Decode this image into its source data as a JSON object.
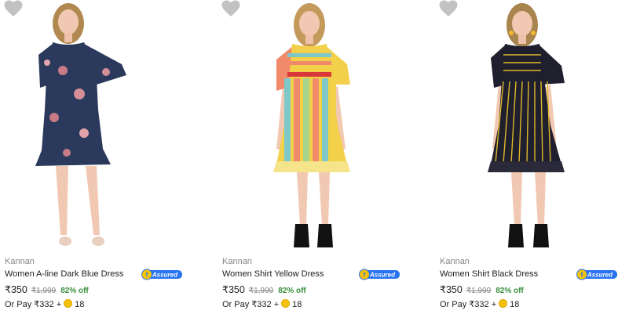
{
  "products": [
    {
      "brand": "Kannan",
      "title": "Women A-line Dark Blue Dress",
      "price": "₹350",
      "mrp": "₹1,999",
      "discount": "82% off",
      "pay_prefix": "Or Pay ₹332 +",
      "coins": "18",
      "assured_label": "Assured",
      "dress_color": "#2b3a5c",
      "icon": "heart-icon"
    },
    {
      "brand": "Kannan",
      "title": "Women Shirt Yellow Dress",
      "price": "₹350",
      "mrp": "₹1,999",
      "discount": "82% off",
      "pay_prefix": "Or Pay ₹332 +",
      "coins": "18",
      "assured_label": "Assured",
      "dress_color": "#f2d04a",
      "icon": "heart-icon"
    },
    {
      "brand": "Kannan",
      "title": "Women Shirt Black Dress",
      "price": "₹350",
      "mrp": "₹1,999",
      "discount": "82% off",
      "pay_prefix": "Or Pay ₹332 +",
      "coins": "18",
      "assured_label": "Assured",
      "dress_color": "#1f1f2e",
      "icon": "heart-icon"
    }
  ],
  "colors": {
    "assured_blue": "#2874f0",
    "discount_green": "#388e3c",
    "wishlist_grey": "#c2c2c2"
  }
}
